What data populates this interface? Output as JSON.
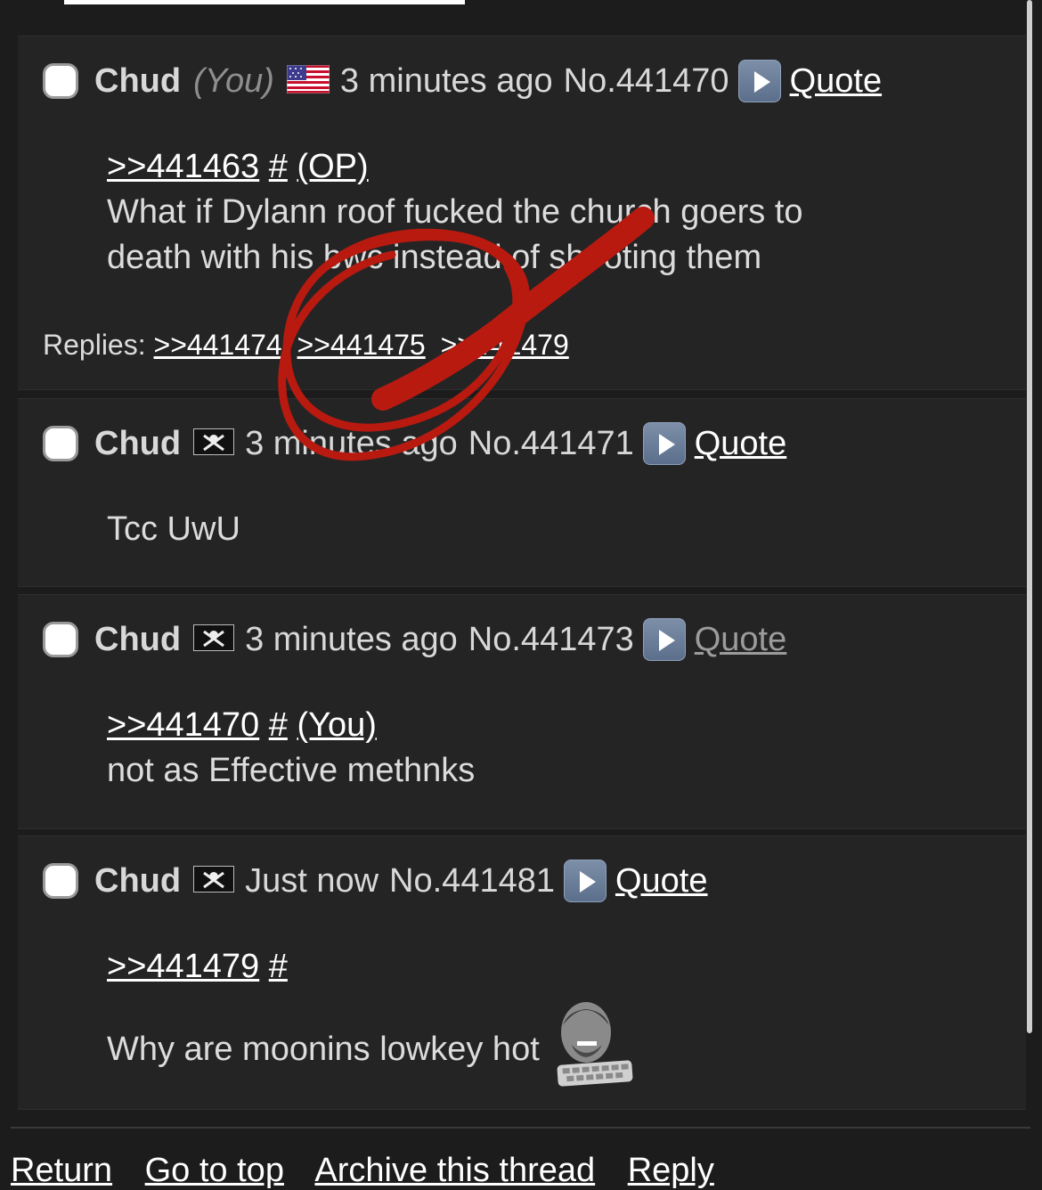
{
  "posts": [
    {
      "name": "Chud",
      "you_tag": "(You)",
      "flag_icon": "us-flag-icon",
      "time": "3 minutes ago",
      "number": "No.441470",
      "quote_label": "Quote",
      "reply_link": ">>441463",
      "reply_hash": "#",
      "reply_tag": "(OP)",
      "text_line1": "What if Dylann roof fucked the church goers to",
      "text_line2": "death with his bwc instead of shooting them",
      "replies_label": "Replies:",
      "replies": [
        ">>441474",
        ">>441475",
        ">>441479"
      ]
    },
    {
      "name": "Chud",
      "flag_icon": "pirate-flag-icon",
      "time": "3 minutes ago",
      "number": "No.441471",
      "quote_label": "Quote",
      "text": "Tcc UwU"
    },
    {
      "name": "Chud",
      "flag_icon": "pirate-flag-icon",
      "time": "3 minutes ago",
      "number": "No.441473",
      "quote_label": "Quote",
      "reply_link": ">>441470",
      "reply_hash": "#",
      "reply_tag": "(You)",
      "text": "not as Effective methnks"
    },
    {
      "name": "Chud",
      "flag_icon": "pirate-flag-icon",
      "time": "Just now",
      "number": "No.441481",
      "quote_label": "Quote",
      "reply_link": ">>441479",
      "reply_hash": "#",
      "text": "Why are moonins lowkey hot",
      "emoji_icon": "chad-keyboard-emoji"
    }
  ],
  "footer": {
    "return": "Return",
    "go_to_top": "Go to top",
    "archive": "Archive this thread",
    "reply": "Reply"
  },
  "colors": {
    "background": "#1c1c1c",
    "post_background": "#242424",
    "scribble": "#b81a10"
  }
}
